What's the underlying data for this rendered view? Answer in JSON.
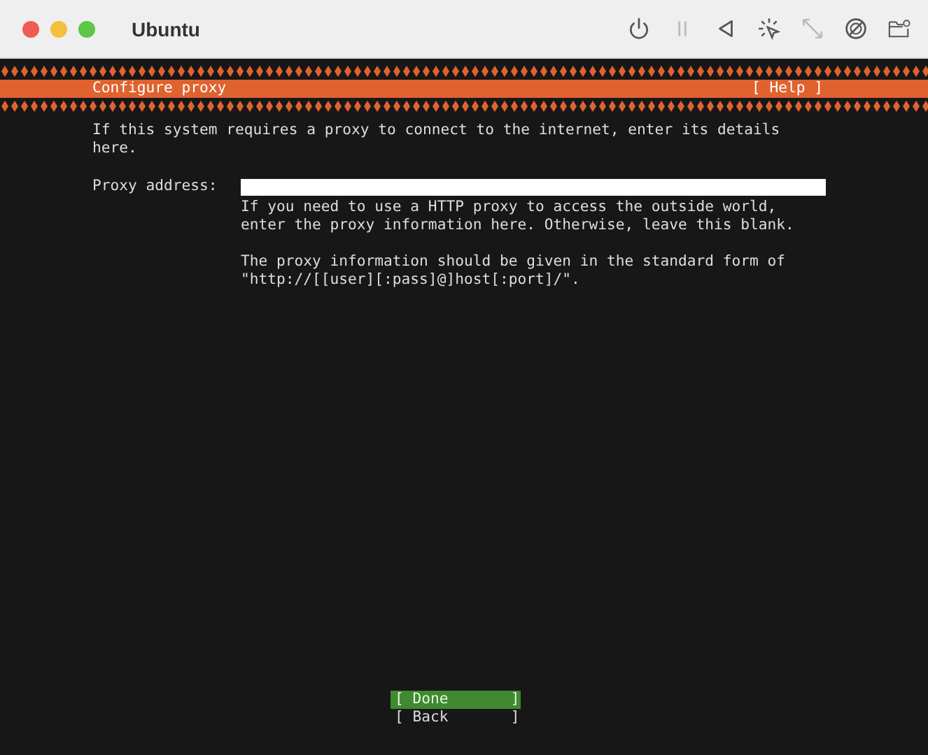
{
  "window": {
    "title": "Ubuntu"
  },
  "toolbar": [
    {
      "kind": "power",
      "disabled": false
    },
    {
      "kind": "pause",
      "disabled": true
    },
    {
      "kind": "back",
      "disabled": false
    },
    {
      "kind": "pointer",
      "disabled": false
    },
    {
      "kind": "resize",
      "disabled": true
    },
    {
      "kind": "disc",
      "disabled": false
    },
    {
      "kind": "folder",
      "disabled": false
    }
  ],
  "header": {
    "title": "Configure proxy",
    "help": "[ Help ]"
  },
  "description": [
    "If this system requires a proxy to connect to the internet, enter its details",
    "here."
  ],
  "field": {
    "label": "Proxy address:"
  },
  "help_text": [
    [
      "If you need to use a HTTP proxy to access the outside world,",
      "enter the proxy information here. Otherwise, leave this blank."
    ],
    [
      "The proxy information should be given in the standard form of",
      "\"http://[[user][:pass]@]host[:port]/\"."
    ]
  ],
  "buttons": [
    {
      "label": "[ Done       ]",
      "selected": true
    },
    {
      "label": "[ Back       ]",
      "selected": false
    }
  ]
}
